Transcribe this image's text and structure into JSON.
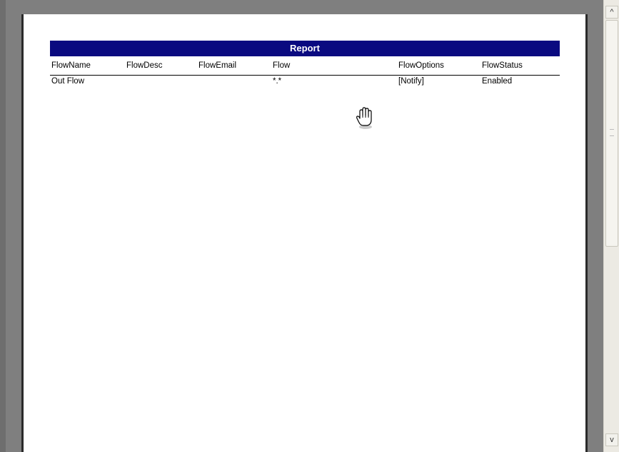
{
  "report": {
    "title": "Report",
    "columns": [
      "FlowName",
      "FlowDesc",
      "FlowEmail",
      "Flow",
      "FlowOptions",
      "FlowStatus"
    ],
    "rows": [
      [
        "Out Flow",
        "",
        "",
        "*.*",
        "[Notify]",
        "Enabled"
      ]
    ]
  },
  "scrollbar": {
    "up_icon": "chevron-up-icon",
    "down_icon": "chevron-down-icon",
    "up_glyph": "^",
    "down_glyph": "v"
  },
  "cursor": {
    "icon": "hand-cursor-icon"
  }
}
